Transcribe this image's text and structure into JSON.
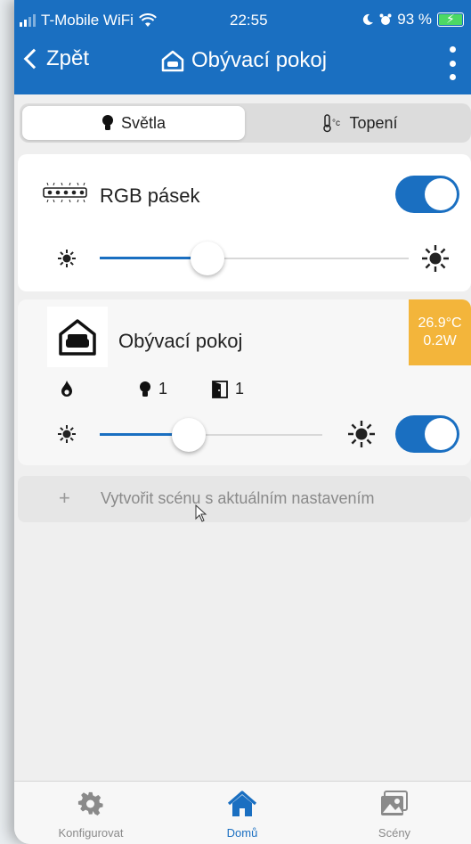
{
  "status_bar": {
    "carrier": "T-Mobile WiFi",
    "time": "22:55",
    "battery": "93 %"
  },
  "nav": {
    "back_label": "Zpět",
    "title": "Obývací pokoj"
  },
  "segments": [
    {
      "label": "Světla",
      "active": true
    },
    {
      "label": "Topení",
      "active": false
    }
  ],
  "device": {
    "name": "RGB pásek",
    "on": true,
    "brightness_fraction": 0.35
  },
  "room": {
    "name": "Obývací pokoj",
    "temperature": "26.9°C",
    "power": "0.2W",
    "lights_count": "1",
    "doors_count": "1",
    "on": true,
    "brightness_fraction": 0.4
  },
  "scene_action": {
    "plus": "+",
    "label": "Vytvořit scénu s aktuálním nastavením"
  },
  "tabbar": [
    {
      "label": "Konfigurovat",
      "icon": "gear-icon",
      "active": false
    },
    {
      "label": "Domů",
      "icon": "home-icon",
      "active": true
    },
    {
      "label": "Scény",
      "icon": "picture-icon",
      "active": false
    }
  ],
  "colors": {
    "accent": "#1a6fc1",
    "badge": "#f3b53b"
  }
}
